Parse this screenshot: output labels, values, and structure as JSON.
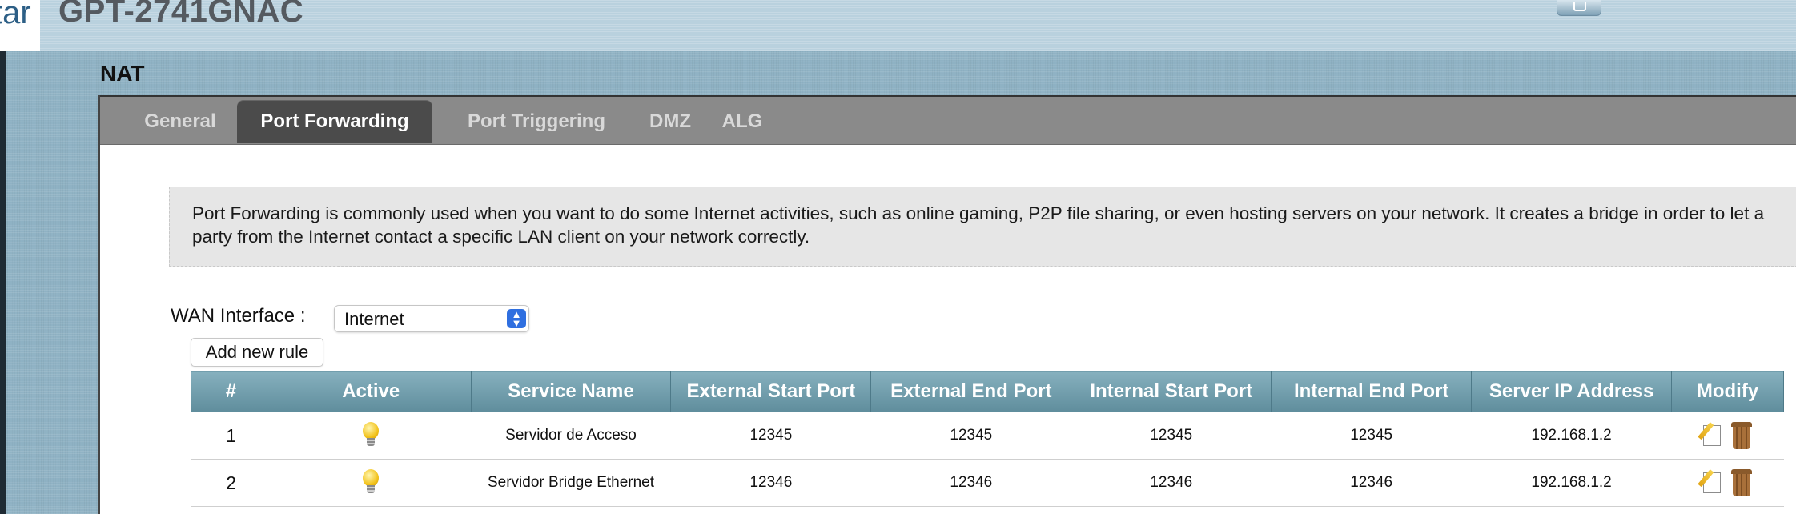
{
  "header": {
    "logo_text": "tar",
    "device_title": "GPT-2741GNAC"
  },
  "page": {
    "title": "NAT"
  },
  "tabs": [
    {
      "label": "General",
      "active": false
    },
    {
      "label": "Port Forwarding",
      "active": true
    },
    {
      "label": "Port Triggering",
      "active": false
    },
    {
      "label": "DMZ",
      "active": false
    },
    {
      "label": "ALG",
      "active": false
    }
  ],
  "info": {
    "text": "Port Forwarding is commonly used when you want to do some Internet activities, such as online gaming, P2P file sharing, or even hosting servers on your network. It creates a bridge in order to let a party from the Internet contact a specific LAN client on your network correctly."
  },
  "wan": {
    "label": "WAN Interface :",
    "selected": "Internet"
  },
  "add_rule_label": "Add new rule",
  "table": {
    "headers": [
      "#",
      "Active",
      "Service Name",
      "External Start Port",
      "External End Port",
      "Internal Start Port",
      "Internal End Port",
      "Server IP Address",
      "Modify"
    ],
    "rows": [
      {
        "num": "1",
        "service": "Servidor de Acceso",
        "ext_start": "12345",
        "ext_end": "12345",
        "int_start": "12345",
        "int_end": "12345",
        "server_ip": "192.168.1.2"
      },
      {
        "num": "2",
        "service": "Servidor Bridge Ethernet",
        "ext_start": "12346",
        "ext_end": "12346",
        "int_start": "12346",
        "int_end": "12346",
        "server_ip": "192.168.1.2"
      }
    ]
  },
  "colors": {
    "table_header": "#6f9aa9",
    "tab_active": "#4b4b4b",
    "tab_bar": "#8a8a8a",
    "select_accent": "#2f6fe0"
  },
  "icons": {
    "active": "lightbulb-icon",
    "edit": "edit-icon",
    "delete": "trash-icon"
  }
}
